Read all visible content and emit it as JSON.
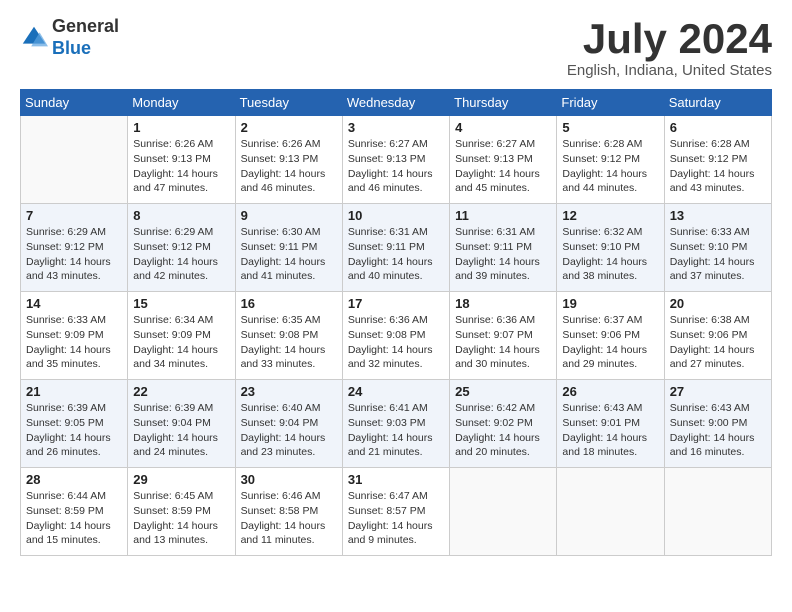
{
  "header": {
    "logo_general": "General",
    "logo_blue": "Blue",
    "title": "July 2024",
    "location": "English, Indiana, United States"
  },
  "days_of_week": [
    "Sunday",
    "Monday",
    "Tuesday",
    "Wednesday",
    "Thursday",
    "Friday",
    "Saturday"
  ],
  "weeks": [
    [
      {
        "num": "",
        "info": ""
      },
      {
        "num": "1",
        "info": "Sunrise: 6:26 AM\nSunset: 9:13 PM\nDaylight: 14 hours\nand 47 minutes."
      },
      {
        "num": "2",
        "info": "Sunrise: 6:26 AM\nSunset: 9:13 PM\nDaylight: 14 hours\nand 46 minutes."
      },
      {
        "num": "3",
        "info": "Sunrise: 6:27 AM\nSunset: 9:13 PM\nDaylight: 14 hours\nand 46 minutes."
      },
      {
        "num": "4",
        "info": "Sunrise: 6:27 AM\nSunset: 9:13 PM\nDaylight: 14 hours\nand 45 minutes."
      },
      {
        "num": "5",
        "info": "Sunrise: 6:28 AM\nSunset: 9:12 PM\nDaylight: 14 hours\nand 44 minutes."
      },
      {
        "num": "6",
        "info": "Sunrise: 6:28 AM\nSunset: 9:12 PM\nDaylight: 14 hours\nand 43 minutes."
      }
    ],
    [
      {
        "num": "7",
        "info": "Sunrise: 6:29 AM\nSunset: 9:12 PM\nDaylight: 14 hours\nand 43 minutes."
      },
      {
        "num": "8",
        "info": "Sunrise: 6:29 AM\nSunset: 9:12 PM\nDaylight: 14 hours\nand 42 minutes."
      },
      {
        "num": "9",
        "info": "Sunrise: 6:30 AM\nSunset: 9:11 PM\nDaylight: 14 hours\nand 41 minutes."
      },
      {
        "num": "10",
        "info": "Sunrise: 6:31 AM\nSunset: 9:11 PM\nDaylight: 14 hours\nand 40 minutes."
      },
      {
        "num": "11",
        "info": "Sunrise: 6:31 AM\nSunset: 9:11 PM\nDaylight: 14 hours\nand 39 minutes."
      },
      {
        "num": "12",
        "info": "Sunrise: 6:32 AM\nSunset: 9:10 PM\nDaylight: 14 hours\nand 38 minutes."
      },
      {
        "num": "13",
        "info": "Sunrise: 6:33 AM\nSunset: 9:10 PM\nDaylight: 14 hours\nand 37 minutes."
      }
    ],
    [
      {
        "num": "14",
        "info": "Sunrise: 6:33 AM\nSunset: 9:09 PM\nDaylight: 14 hours\nand 35 minutes."
      },
      {
        "num": "15",
        "info": "Sunrise: 6:34 AM\nSunset: 9:09 PM\nDaylight: 14 hours\nand 34 minutes."
      },
      {
        "num": "16",
        "info": "Sunrise: 6:35 AM\nSunset: 9:08 PM\nDaylight: 14 hours\nand 33 minutes."
      },
      {
        "num": "17",
        "info": "Sunrise: 6:36 AM\nSunset: 9:08 PM\nDaylight: 14 hours\nand 32 minutes."
      },
      {
        "num": "18",
        "info": "Sunrise: 6:36 AM\nSunset: 9:07 PM\nDaylight: 14 hours\nand 30 minutes."
      },
      {
        "num": "19",
        "info": "Sunrise: 6:37 AM\nSunset: 9:06 PM\nDaylight: 14 hours\nand 29 minutes."
      },
      {
        "num": "20",
        "info": "Sunrise: 6:38 AM\nSunset: 9:06 PM\nDaylight: 14 hours\nand 27 minutes."
      }
    ],
    [
      {
        "num": "21",
        "info": "Sunrise: 6:39 AM\nSunset: 9:05 PM\nDaylight: 14 hours\nand 26 minutes."
      },
      {
        "num": "22",
        "info": "Sunrise: 6:39 AM\nSunset: 9:04 PM\nDaylight: 14 hours\nand 24 minutes."
      },
      {
        "num": "23",
        "info": "Sunrise: 6:40 AM\nSunset: 9:04 PM\nDaylight: 14 hours\nand 23 minutes."
      },
      {
        "num": "24",
        "info": "Sunrise: 6:41 AM\nSunset: 9:03 PM\nDaylight: 14 hours\nand 21 minutes."
      },
      {
        "num": "25",
        "info": "Sunrise: 6:42 AM\nSunset: 9:02 PM\nDaylight: 14 hours\nand 20 minutes."
      },
      {
        "num": "26",
        "info": "Sunrise: 6:43 AM\nSunset: 9:01 PM\nDaylight: 14 hours\nand 18 minutes."
      },
      {
        "num": "27",
        "info": "Sunrise: 6:43 AM\nSunset: 9:00 PM\nDaylight: 14 hours\nand 16 minutes."
      }
    ],
    [
      {
        "num": "28",
        "info": "Sunrise: 6:44 AM\nSunset: 8:59 PM\nDaylight: 14 hours\nand 15 minutes."
      },
      {
        "num": "29",
        "info": "Sunrise: 6:45 AM\nSunset: 8:59 PM\nDaylight: 14 hours\nand 13 minutes."
      },
      {
        "num": "30",
        "info": "Sunrise: 6:46 AM\nSunset: 8:58 PM\nDaylight: 14 hours\nand 11 minutes."
      },
      {
        "num": "31",
        "info": "Sunrise: 6:47 AM\nSunset: 8:57 PM\nDaylight: 14 hours\nand 9 minutes."
      },
      {
        "num": "",
        "info": ""
      },
      {
        "num": "",
        "info": ""
      },
      {
        "num": "",
        "info": ""
      }
    ]
  ]
}
